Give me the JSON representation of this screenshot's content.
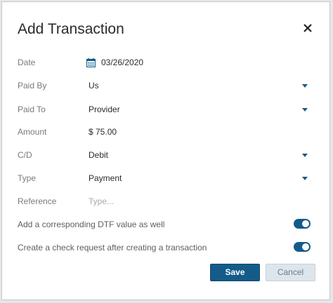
{
  "dialog": {
    "title": "Add Transaction",
    "fields": {
      "date": {
        "label": "Date",
        "value": "03/26/2020"
      },
      "paid_by": {
        "label": "Paid By",
        "value": "Us"
      },
      "paid_to": {
        "label": "Paid To",
        "value": "Provider"
      },
      "amount": {
        "label": "Amount",
        "value": "$ 75.00"
      },
      "cd": {
        "label": "C/D",
        "value": "Debit"
      },
      "type": {
        "label": "Type",
        "value": "Payment"
      },
      "reference": {
        "label": "Reference",
        "placeholder": "Type..."
      }
    },
    "toggles": {
      "dtf": {
        "label": "Add a corresponding DTF value as well",
        "on": true
      },
      "check_request": {
        "label": "Create a check request after creating a transaction",
        "on": true
      }
    },
    "buttons": {
      "save": "Save",
      "cancel": "Cancel"
    }
  },
  "icons": {
    "close": "close-icon",
    "calendar": "calendar-icon",
    "dropdown": "chevron-down-icon"
  },
  "colors": {
    "accent": "#155b8a",
    "cancel_bg": "#dde5ec"
  }
}
